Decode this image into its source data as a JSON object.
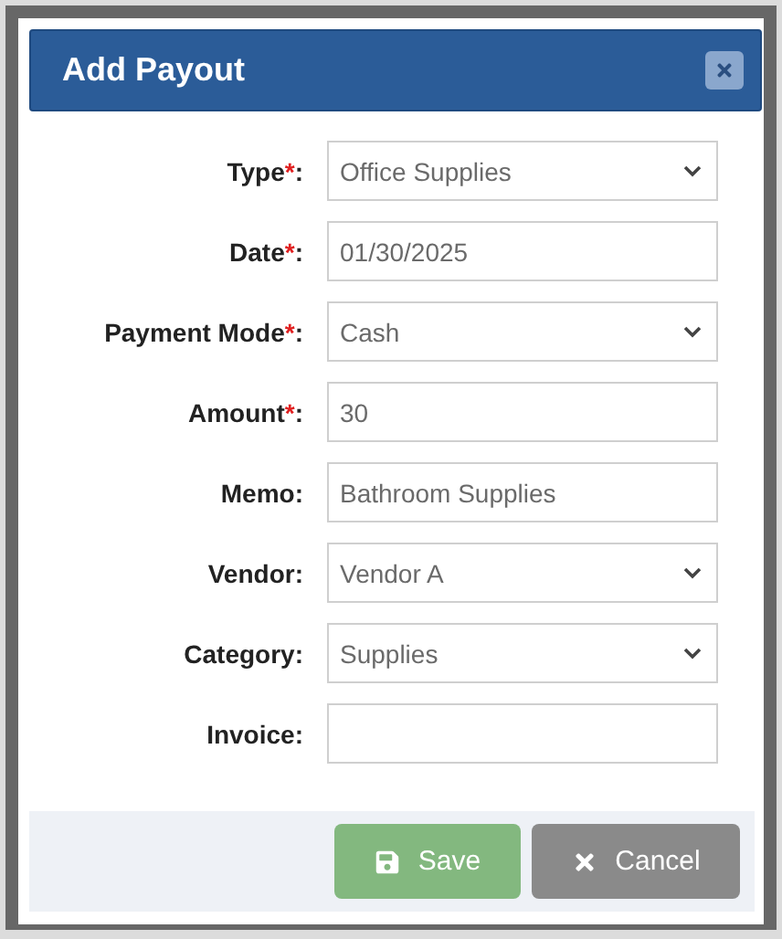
{
  "dialog": {
    "title": "Add Payout"
  },
  "fields": [
    {
      "label": "Type",
      "required_mark": "*",
      "suffix": ":",
      "kind": "select",
      "value": "Office Supplies"
    },
    {
      "label": "Date",
      "required_mark": "*",
      "suffix": ":",
      "kind": "text",
      "value": "01/30/2025"
    },
    {
      "label": "Payment Mode",
      "required_mark": "*",
      "suffix": ":",
      "kind": "select",
      "value": "Cash"
    },
    {
      "label": "Amount",
      "required_mark": "*",
      "suffix": ":",
      "kind": "text",
      "value": "30"
    },
    {
      "label": "Memo",
      "suffix": ":",
      "kind": "text",
      "value": "Bathroom Supplies"
    },
    {
      "label": "Vendor",
      "suffix": ":",
      "kind": "select",
      "value": "Vendor A"
    },
    {
      "label": "Category",
      "suffix": ":",
      "kind": "select",
      "value": "Supplies"
    },
    {
      "label": "Invoice",
      "suffix": ":",
      "kind": "text"
    }
  ],
  "buttons": [
    {
      "label": "Save",
      "kind": "save"
    },
    {
      "label": "Cancel",
      "kind": "cancel"
    }
  ]
}
